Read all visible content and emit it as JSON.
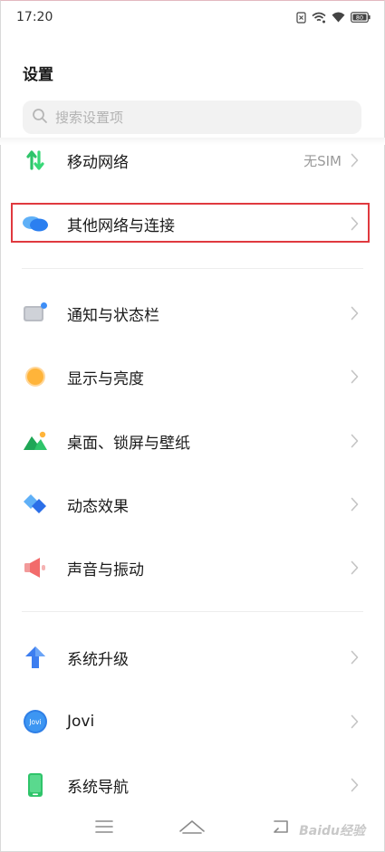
{
  "status_bar": {
    "time": "17:20",
    "battery": "80"
  },
  "page": {
    "title": "设置"
  },
  "search": {
    "placeholder": "搜索设置项"
  },
  "items": {
    "mobile_network": {
      "label": "移动网络",
      "value": "无SIM"
    },
    "other_network": {
      "label": "其他网络与连接"
    },
    "notification": {
      "label": "通知与状态栏"
    },
    "display": {
      "label": "显示与亮度"
    },
    "desktop": {
      "label": "桌面、锁屏与壁纸"
    },
    "animation": {
      "label": "动态效果"
    },
    "sound": {
      "label": "声音与振动"
    },
    "system_upgrade": {
      "label": "系统升级"
    },
    "jovi": {
      "label": "Jovi",
      "icon_text": "Jovi"
    },
    "system_nav": {
      "label": "系统导航"
    }
  },
  "watermark": "Baidu经验",
  "colors": {
    "highlight_border": "#e0393f",
    "accent_blue": "#3d8ef7",
    "green": "#2fc46a",
    "orange": "#ffb43a",
    "red": "#f26b6b"
  }
}
